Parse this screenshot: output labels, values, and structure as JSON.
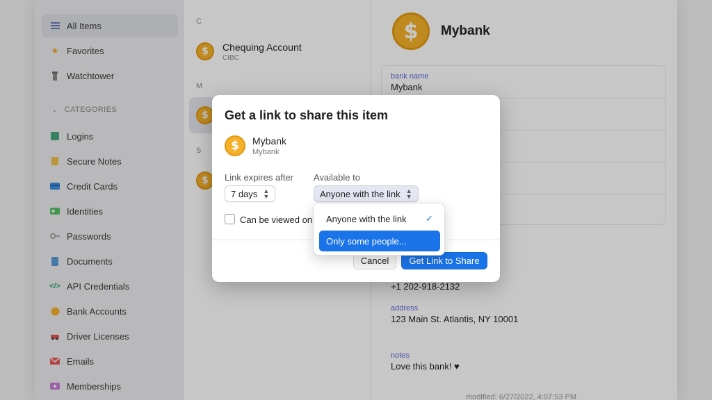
{
  "sidebar": {
    "items": [
      {
        "label": "All Items",
        "icon": "list-icon"
      },
      {
        "label": "Favorites",
        "icon": "star-icon"
      },
      {
        "label": "Watchtower",
        "icon": "watchtower-icon"
      }
    ],
    "categories_header": "CATEGORIES",
    "categories": [
      {
        "label": "Logins",
        "icon": "login-icon"
      },
      {
        "label": "Secure Notes",
        "icon": "note-icon"
      },
      {
        "label": "Credit Cards",
        "icon": "credit-card-icon"
      },
      {
        "label": "Identities",
        "icon": "identity-icon"
      },
      {
        "label": "Passwords",
        "icon": "key-icon"
      },
      {
        "label": "Documents",
        "icon": "document-icon"
      },
      {
        "label": "API Credentials",
        "icon": "code-icon"
      },
      {
        "label": "Bank Accounts",
        "icon": "bank-coin-icon"
      },
      {
        "label": "Driver Licenses",
        "icon": "car-icon"
      },
      {
        "label": "Emails",
        "icon": "email-icon"
      },
      {
        "label": "Memberships",
        "icon": "membership-icon"
      }
    ]
  },
  "list": {
    "sections": [
      "C",
      "M",
      "S"
    ],
    "items": [
      {
        "title": "Chequing Account",
        "subtitle": "CIBC"
      }
    ]
  },
  "detail": {
    "title": "Mybank",
    "fields": {
      "bank_name_label": "bank name",
      "bank_name_value": "Mybank",
      "phone_value": "+1 202-918-2132",
      "address_label": "address",
      "address_value": "123 Main St. Atlantis, NY 10001",
      "notes_label": "notes",
      "notes_value": "Love this bank! ♥"
    },
    "modified": "modified: 6/27/2022, 4:07:53 PM"
  },
  "dialog": {
    "title": "Get a link to share this item",
    "item_title": "Mybank",
    "item_subtitle": "Mybank",
    "expires_label": "Link expires after",
    "expires_value": "7 days",
    "available_label": "Available to",
    "available_value": "Anyone with the link",
    "checkbox_label": "Can be viewed on",
    "cancel_label": "Cancel",
    "primary_label": "Get Link to Share"
  },
  "dropdown": {
    "options": [
      {
        "label": "Anyone with the link",
        "checked": true
      },
      {
        "label": "Only some people...",
        "highlighted": true
      }
    ]
  },
  "colors": {
    "accent": "#1a73e8",
    "coin": "#f5b12a",
    "field_label": "#5b6bd6"
  }
}
